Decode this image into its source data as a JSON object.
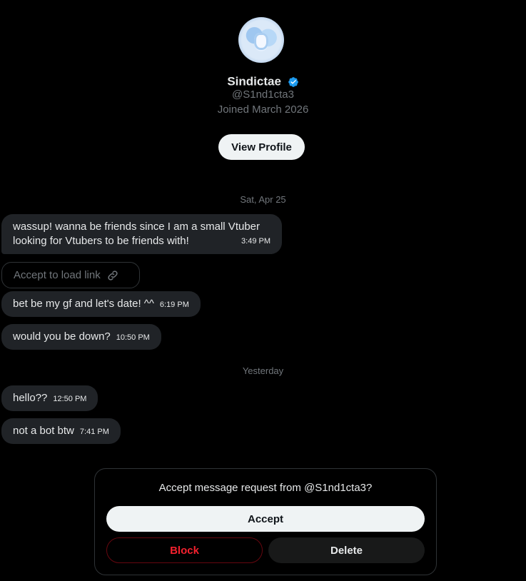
{
  "profile": {
    "name": "Sindictae",
    "handle": "@S1nd1cta3",
    "joined": "Joined March 2026",
    "view_profile_label": "View Profile"
  },
  "conversation": {
    "date_separators": [
      "Sat, Apr 25",
      "Yesterday"
    ],
    "link_placeholder": "Accept to load link",
    "messages": [
      {
        "text": "wassup! wanna be friends since I am a small Vtuber looking for Vtubers to be friends with!",
        "time": "3:49 PM"
      },
      {
        "text": "bet be my gf and let's date! ^^",
        "time": "6:19 PM"
      },
      {
        "text": "would you be down?",
        "time": "10:50 PM"
      },
      {
        "text": "hello??",
        "time": "12:50 PM"
      },
      {
        "text": "not a bot btw",
        "time": "7:41 PM"
      }
    ]
  },
  "request": {
    "title": "Accept message request from @S1nd1cta3?",
    "accept_label": "Accept",
    "block_label": "Block",
    "delete_label": "Delete"
  },
  "colors": {
    "background": "#000000",
    "bubble": "#202327",
    "muted": "#71767b",
    "verified": "#1d9bf0",
    "danger": "#f4212e"
  },
  "icons": {
    "verified": "verified-badge-icon",
    "link": "link-icon"
  }
}
